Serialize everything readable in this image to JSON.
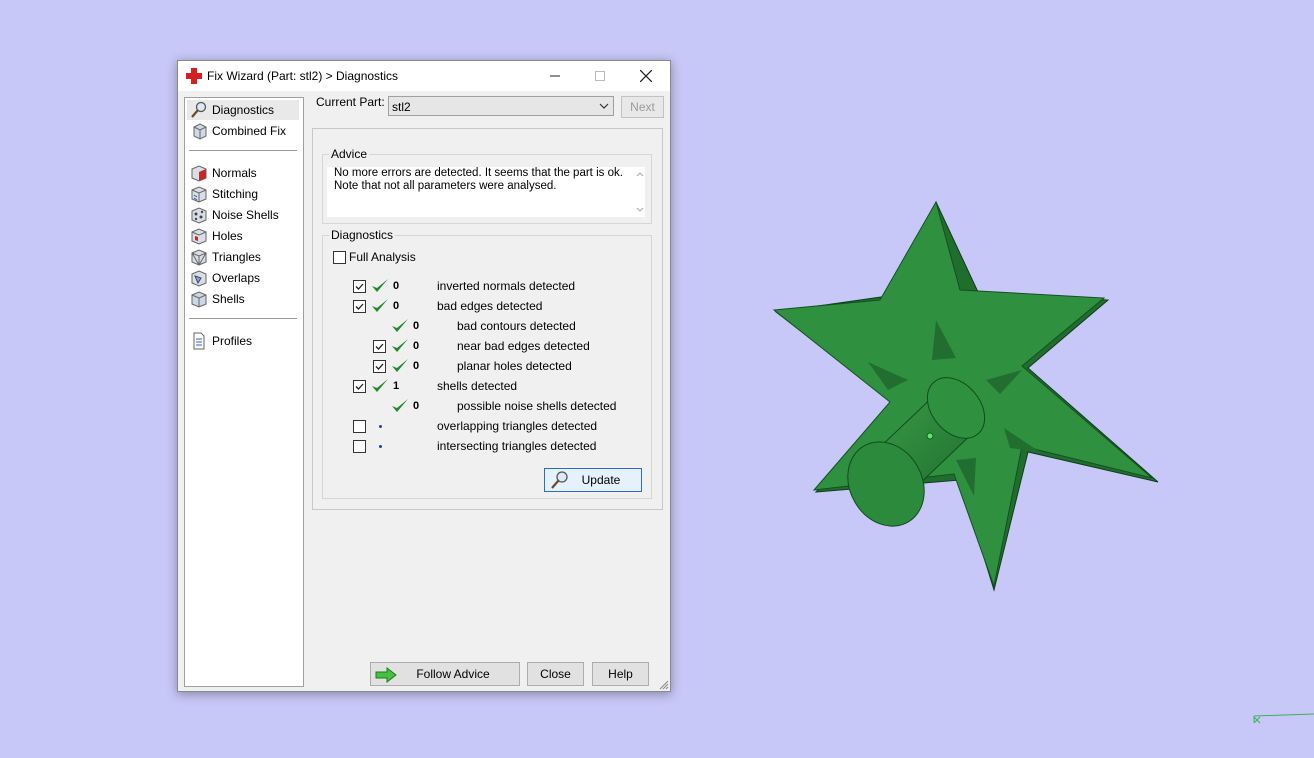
{
  "window": {
    "title": "Fix Wizard (Part: stl2) > Diagnostics"
  },
  "nav": {
    "items": [
      {
        "label": "Diagnostics",
        "icon": "magnifier-icon",
        "selected": true
      },
      {
        "label": "Combined Fix",
        "icon": "combined-fix-icon"
      },
      {
        "label": "Normals",
        "icon": "normals-icon"
      },
      {
        "label": "Stitching",
        "icon": "stitching-icon"
      },
      {
        "label": "Noise Shells",
        "icon": "noise-shells-icon"
      },
      {
        "label": "Holes",
        "icon": "holes-icon"
      },
      {
        "label": "Triangles",
        "icon": "triangles-icon"
      },
      {
        "label": "Overlaps",
        "icon": "overlaps-icon"
      },
      {
        "label": "Shells",
        "icon": "shells-icon"
      },
      {
        "label": "Profiles",
        "icon": "profiles-icon"
      }
    ]
  },
  "part": {
    "label": "Current Part:",
    "value": "stl2",
    "next_label": "Next"
  },
  "advice": {
    "title": "Advice",
    "line1": "No more errors are detected. It seems that the part is ok.",
    "line2": "Note that not all parameters were analysed."
  },
  "diagnostics": {
    "title": "Diagnostics",
    "full_analysis_label": "Full Analysis",
    "full_analysis_checked": false,
    "rows": [
      {
        "checked": true,
        "status": "ok",
        "count": "0",
        "label": "inverted normals detected"
      },
      {
        "checked": true,
        "status": "ok",
        "count": "0",
        "label": "bad edges detected"
      },
      {
        "checked": null,
        "status": "ok",
        "count": "0",
        "label": "bad contours detected"
      },
      {
        "checked": true,
        "status": "ok",
        "count": "0",
        "label": "near bad edges detected"
      },
      {
        "checked": true,
        "status": "ok",
        "count": "0",
        "label": "planar holes detected"
      },
      {
        "checked": true,
        "status": "ok",
        "count": "1",
        "label": "shells detected"
      },
      {
        "checked": null,
        "status": "ok",
        "count": "0",
        "label": "possible noise shells detected"
      },
      {
        "checked": false,
        "status": "pending",
        "count": "",
        "label": "overlapping triangles detected"
      },
      {
        "checked": false,
        "status": "pending",
        "count": "",
        "label": "intersecting triangles detected"
      }
    ],
    "update_label": "Update"
  },
  "footer": {
    "follow_advice_label": "Follow Advice",
    "close_label": "Close",
    "help_label": "Help"
  },
  "colors": {
    "viewport_bg": "#c8c8f8",
    "model_green": "#2e8b3e",
    "check_green": "#1d8a2a"
  }
}
